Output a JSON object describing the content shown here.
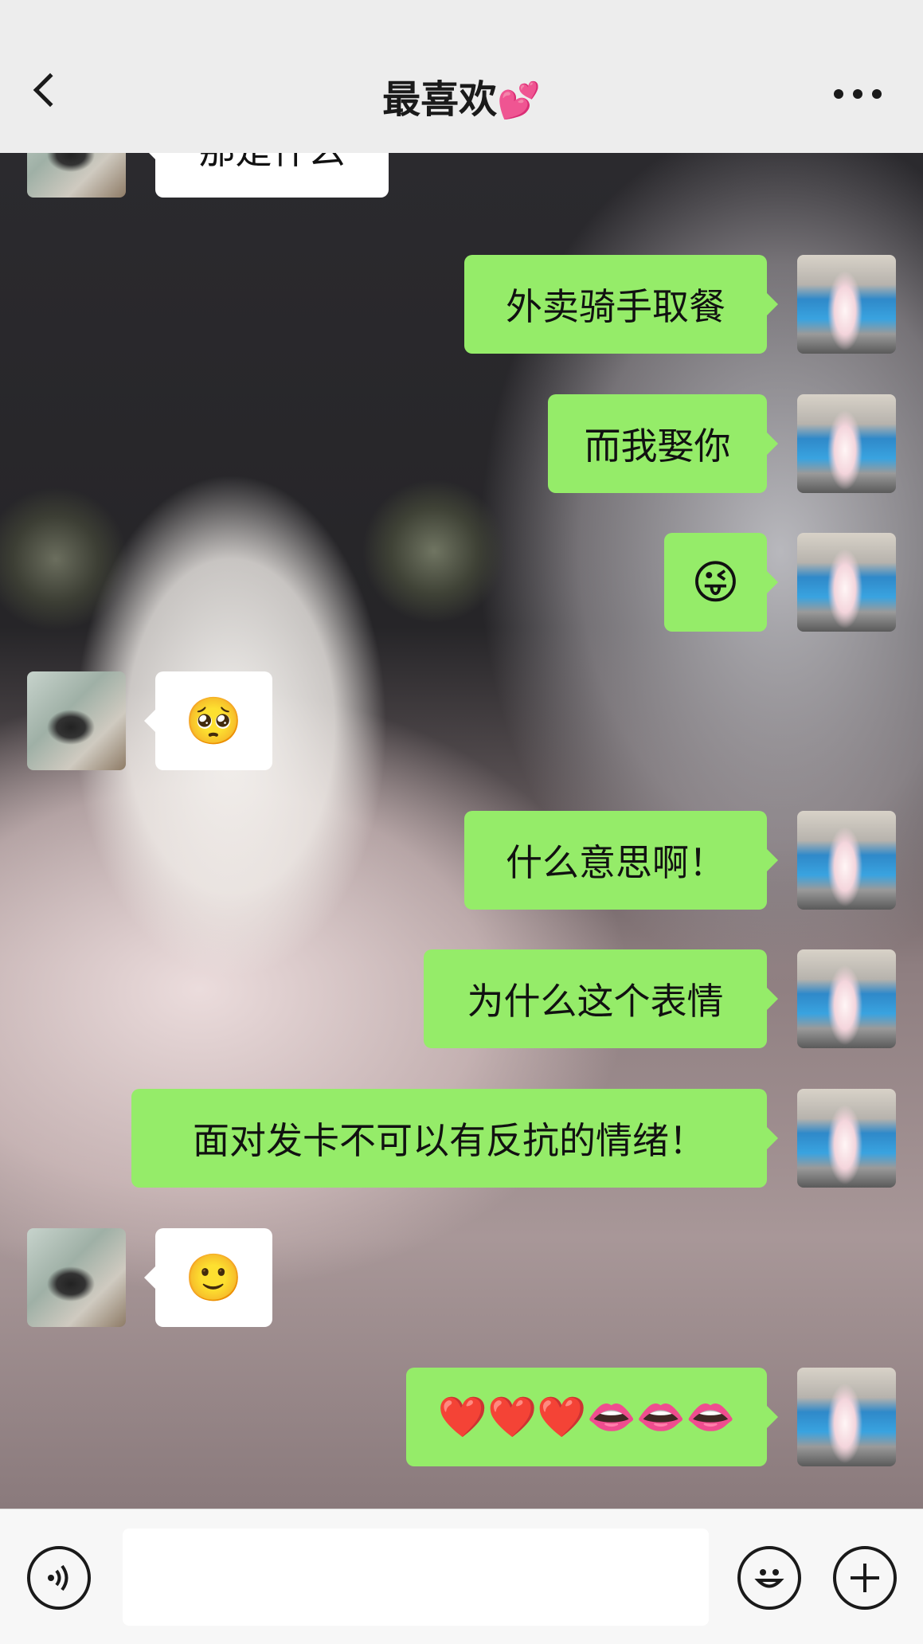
{
  "header": {
    "title": "最喜欢",
    "title_emoji": "💕",
    "back_icon": "chevron-left-icon",
    "more_icon": "more-dots-icon"
  },
  "messages": [
    {
      "side": "left",
      "text": "那是什么"
    },
    {
      "side": "right",
      "text": "外卖骑手取餐"
    },
    {
      "side": "right",
      "text": "而我娶你"
    },
    {
      "side": "right",
      "text": "😜"
    },
    {
      "side": "left",
      "text": "🥺"
    },
    {
      "side": "right",
      "text": "什么意思啊！"
    },
    {
      "side": "right",
      "text": "为什么这个表情"
    },
    {
      "side": "right",
      "text": "面对发卡不可以有反抗的情绪！"
    },
    {
      "side": "left",
      "text": "🙂"
    },
    {
      "side": "right",
      "text": "❤️❤️❤️👄👄👄"
    }
  ],
  "input_bar": {
    "voice_icon": "voice-icon",
    "emoji_icon": "smiley-icon",
    "plus_icon": "plus-icon",
    "placeholder": ""
  },
  "colors": {
    "bubble_self": "#95ec69",
    "bubble_other": "#ffffff",
    "header_bg": "#ededed"
  }
}
